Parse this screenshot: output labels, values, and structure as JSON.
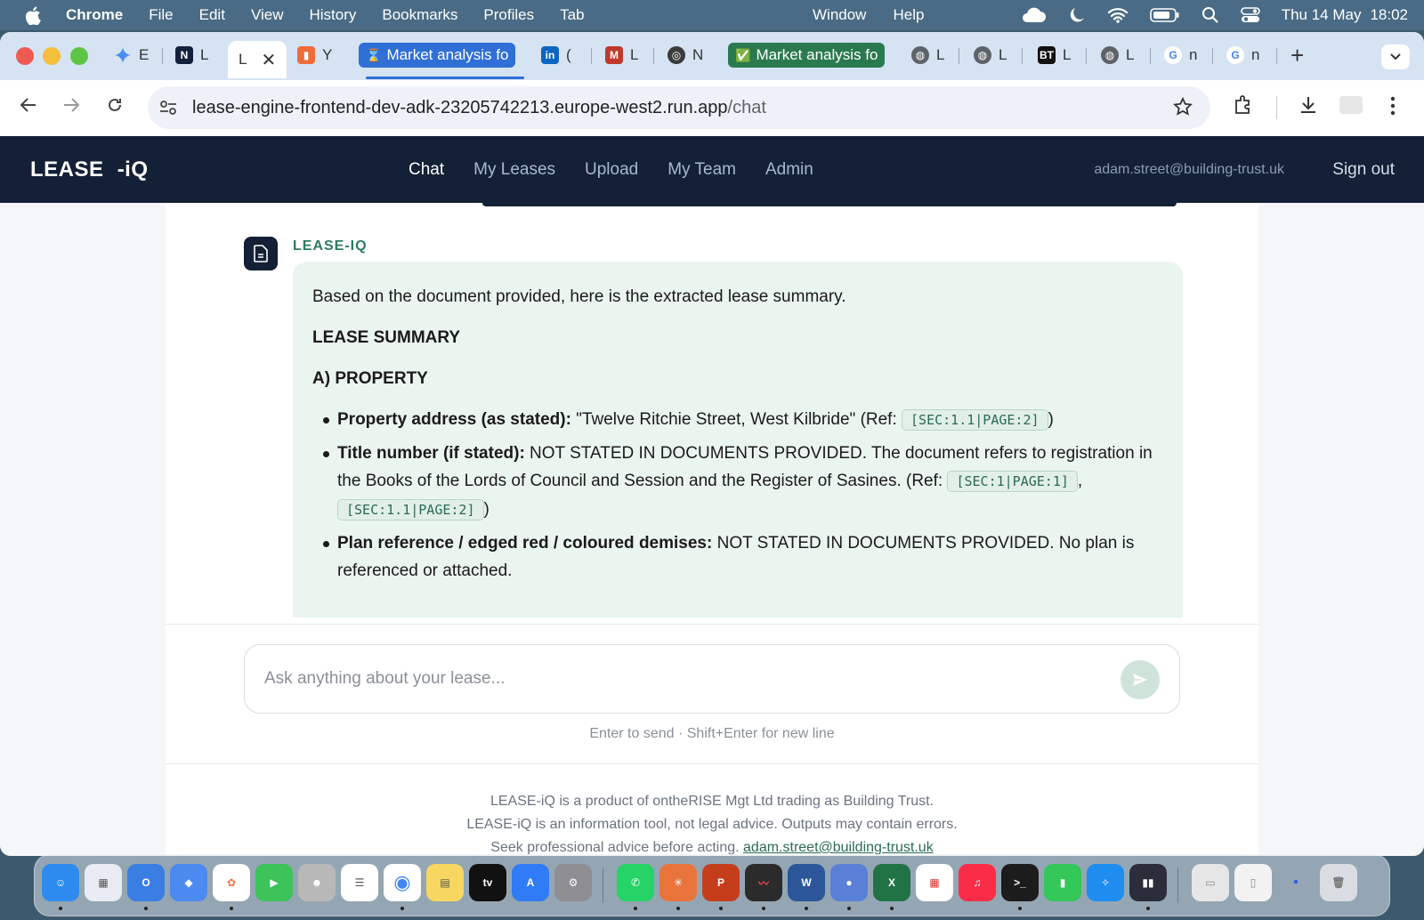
{
  "menubar": {
    "app": "Chrome",
    "items": [
      "File",
      "Edit",
      "View",
      "History",
      "Bookmarks",
      "Profiles",
      "Tab"
    ],
    "right_items": [
      "Window",
      "Help"
    ],
    "date": "Thu 14 May",
    "time": "18:02"
  },
  "tabs": {
    "t1": "E",
    "t2": "L",
    "t3": "L",
    "t4": "Y",
    "market1": "Market analysis fo",
    "t6": "(",
    "t7": "L",
    "t8": "N",
    "market2": "Market analysis fo",
    "t10": "L",
    "t11": "L",
    "t12": "L",
    "t13": "L",
    "t14": "n",
    "t15": "n"
  },
  "address": {
    "host": "lease-engine-frontend-dev-adk-23205742213.europe-west2.run.app",
    "path": "/chat"
  },
  "app": {
    "logo_left": "LEASE",
    "logo_right": "-iQ",
    "nav": [
      "Chat",
      "My Leases",
      "Upload",
      "My Team",
      "Admin"
    ],
    "user_email": "adam.street@building-trust.uk",
    "sign_out": "Sign out"
  },
  "message": {
    "sender": "LEASE-IQ",
    "intro": "Based on the document provided, here is the extracted lease summary.",
    "heading": "LEASE SUMMARY",
    "section": "A) PROPERTY",
    "b1_label": "Property address (as stated):",
    "b1_text": " \"Twelve Ritchie Street, West Kilbride\" (Ref: ",
    "b1_ref": "[SEC:1.1|PAGE:2]",
    "b1_end": ")",
    "b2_label": "Title number (if stated):",
    "b2_text": " NOT STATED IN DOCUMENTS PROVIDED. The document refers to registration in the Books of the Lords of Council and Session and the Register of Sasines. (Ref: ",
    "b2_ref1": "[SEC:1|PAGE:1]",
    "b2_mid": ", ",
    "b2_ref2": "[SEC:1.1|PAGE:2]",
    "b2_end": ")",
    "b3_label": "Plan reference / edged red / coloured demises:",
    "b3_text": " NOT STATED IN DOCUMENTS PROVIDED. No plan is referenced or attached."
  },
  "composer": {
    "placeholder": "Ask anything about your lease...",
    "hint": "Enter to send · Shift+Enter for new line"
  },
  "footer": {
    "line1": "LEASE-iQ is a product of ontheRISE Mgt Ltd trading as Building Trust.",
    "line2": "LEASE-iQ is an information tool, not legal advice. Outputs may contain errors.",
    "line3": "Seek professional advice before acting. ",
    "email": "adam.street@building-trust.uk"
  },
  "colors": {
    "navy": "#132036",
    "accent_green": "#2f7a63",
    "bubble_bg": "#ebf5f0"
  },
  "dock_apps": {
    "tv": "tv"
  }
}
